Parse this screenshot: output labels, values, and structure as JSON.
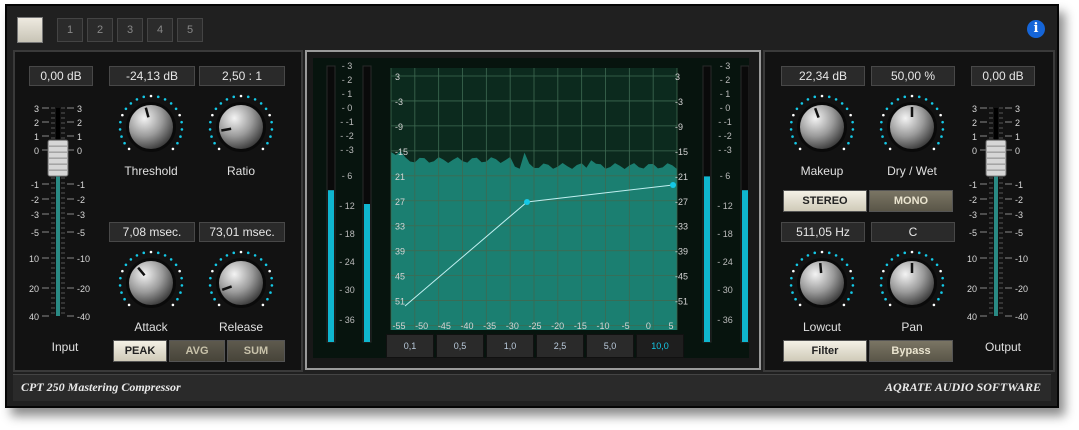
{
  "topbar": {
    "presets": [
      "1",
      "2",
      "3",
      "4",
      "5"
    ],
    "info_label": "i"
  },
  "input_section": {
    "gain_value": "0,00 dB",
    "scale_left": [
      "3",
      "2",
      "1",
      "0",
      "-1",
      "-2",
      "-3",
      "-5",
      "-10",
      "-20",
      "-40"
    ],
    "scale_right": [
      "3",
      "2",
      "1",
      "0",
      "-1",
      "-2",
      "-3",
      "-5",
      "-10",
      "-20",
      "-40"
    ],
    "label": "Input",
    "fader_level": 0.74
  },
  "threshold": {
    "value": "-24,13 dB",
    "label": "Threshold"
  },
  "ratio": {
    "value": "2,50 : 1",
    "label": "Ratio"
  },
  "attack": {
    "value": "7,08 msec.",
    "label": "Attack"
  },
  "release": {
    "value": "73,01 msec.",
    "label": "Release"
  },
  "detector_buttons": [
    {
      "label": "PEAK",
      "active": true
    },
    {
      "label": "AVG",
      "active": false
    },
    {
      "label": "SUM",
      "active": false
    }
  ],
  "graph": {
    "meter_scale": [
      "3",
      "2",
      "1",
      "0",
      "-1",
      "-2",
      "-3",
      "6",
      "12",
      "18",
      "24",
      "30",
      "36"
    ],
    "y_left": [
      "3",
      "-3",
      "-9",
      "-15",
      "21",
      "27",
      "33",
      "39",
      "45",
      "51"
    ],
    "y_right": [
      "3",
      "-3",
      "-9",
      "-15",
      "-21",
      "-27",
      "-33",
      "-39",
      "-45",
      "-51"
    ],
    "x_labels": [
      "-55",
      "-50",
      "-45",
      "-40",
      "-35",
      "-30",
      "-25",
      "-20",
      "-15",
      "-10",
      "-5",
      "0",
      "5"
    ],
    "zoom_buttons": [
      "0,1",
      "0,5",
      "1,0",
      "2,5",
      "5,0",
      "10,0"
    ],
    "zoom_selected": 5,
    "meter_left_levels": [
      0.55,
      0.5
    ],
    "meter_right_levels": [
      0.6,
      0.55
    ]
  },
  "makeup": {
    "value": "22,34 dB",
    "label": "Makeup"
  },
  "drywet": {
    "value": "50,00 %",
    "label": "Dry / Wet"
  },
  "stereo_buttons": [
    {
      "label": "STEREO",
      "active": true
    },
    {
      "label": "MONO",
      "active": false
    }
  ],
  "lowcut": {
    "value": "511,05 Hz",
    "label": "Lowcut"
  },
  "pan": {
    "value": "C",
    "label": "Pan"
  },
  "filter_buttons": [
    {
      "label": "Filter",
      "active": true
    },
    {
      "label": "Bypass",
      "active": false
    }
  ],
  "output_section": {
    "gain_value": "0,00 dB",
    "scale_left": [
      "3",
      "2",
      "1",
      "0",
      "-1",
      "-2",
      "-3",
      "-5",
      "-10",
      "-20",
      "-40"
    ],
    "scale_right": [
      "3",
      "2",
      "1",
      "0",
      "-1",
      "-2",
      "-3",
      "-5",
      "-10",
      "-20",
      "-40"
    ],
    "label": "Output",
    "fader_level": 0.74
  },
  "footer": {
    "product": "CPT 250 Mastering Compressor",
    "company": "AQRATE AUDIO SOFTWARE"
  },
  "colors": {
    "accent": "#14c8e6",
    "graph_fill": "#1f8e80",
    "graph_bg": "#0c2a1e"
  }
}
